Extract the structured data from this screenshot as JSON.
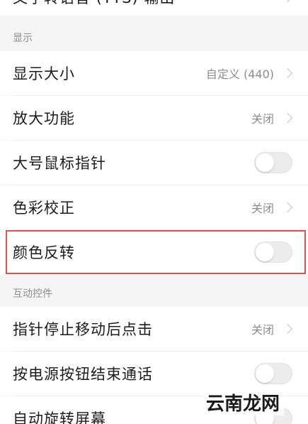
{
  "top_partial": {
    "label": "文字转语音 (TTS) 输出"
  },
  "sections": {
    "display": {
      "header": "显示",
      "items": [
        {
          "label": "显示大小",
          "value": "自定义 (440)"
        },
        {
          "label": "放大功能",
          "value": "关闭"
        },
        {
          "label": "大号鼠标指针",
          "toggle": "off"
        },
        {
          "label": "色彩校正",
          "value": "关闭"
        },
        {
          "label": "颜色反转",
          "toggle": "off",
          "highlighted": true
        }
      ]
    },
    "interaction": {
      "header": "互动控件",
      "items": [
        {
          "label": "指针停止移动后点击",
          "value": "关闭"
        },
        {
          "label": "按电源按钮结束通话",
          "toggle": "off"
        },
        {
          "label": "自动旋转屏幕",
          "toggle": "off"
        }
      ]
    }
  },
  "watermark": "云南龙网",
  "colors": {
    "highlight": "#d9534f",
    "toggle_off": "#ececec"
  }
}
